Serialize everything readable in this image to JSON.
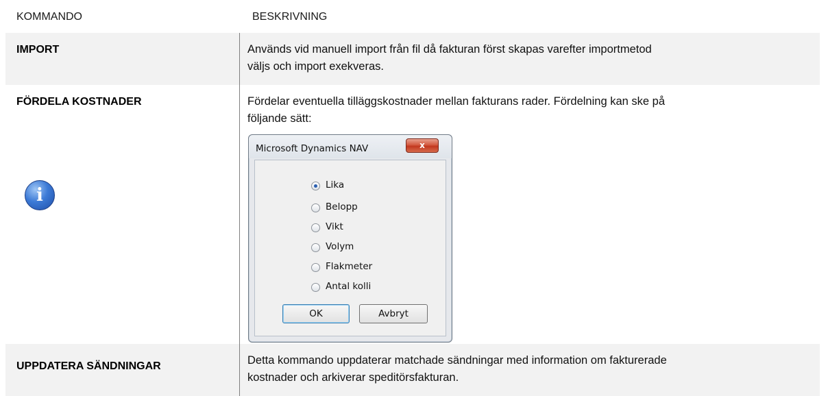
{
  "table": {
    "headers": {
      "command": "KOMMANDO",
      "description": "BESKRIVNING"
    },
    "rows": [
      {
        "command": "IMPORT",
        "lines": [
          "Används vid manuell import från fil då fakturan först skapas varefter importmetod",
          "väljs och import exekveras."
        ]
      },
      {
        "command": "FÖRDELA KOSTNADER",
        "lines": [
          "Fördelar eventuella tilläggskostnader mellan fakturans rader. Fördelning kan ske på",
          "följande sätt:"
        ]
      },
      {
        "command": "UPPDATERA SÄNDNINGAR",
        "lines": [
          "Detta kommando uppdaterar matchade sändningar med information om fakturerade",
          "kostnader och arkiverar speditörsfakturan."
        ]
      }
    ]
  },
  "dialog": {
    "title": "Microsoft Dynamics NAV",
    "close_glyph": "x",
    "info_glyph": "i",
    "options": [
      {
        "label": "Lika",
        "selected": true
      },
      {
        "label": "Belopp",
        "selected": false
      },
      {
        "label": "Vikt",
        "selected": false
      },
      {
        "label": "Volym",
        "selected": false
      },
      {
        "label": "Flakmeter",
        "selected": false
      },
      {
        "label": "Antal kolli",
        "selected": false
      }
    ],
    "buttons": {
      "ok": "OK",
      "cancel": "Avbryt"
    }
  }
}
